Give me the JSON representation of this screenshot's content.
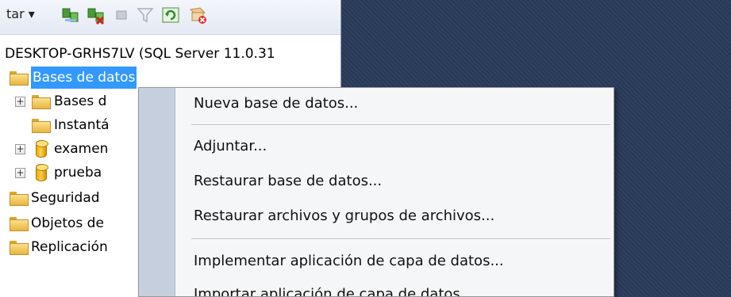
{
  "toolbar": {
    "label": "tar ▾",
    "buttons": [
      "connect-icon",
      "disconnect-icon",
      "stop-icon",
      "filter-icon",
      "refresh-icon",
      "delete-icon"
    ]
  },
  "tree": {
    "server": "DESKTOP-GRHS7LV (SQL Server 11.0.31",
    "items": [
      {
        "label": "Bases de datos",
        "icon": "folder-icon",
        "selected": true
      },
      {
        "label": "Bases d",
        "icon": "folder-icon",
        "expander": "+"
      },
      {
        "label": "Instantá",
        "icon": "folder-icon"
      },
      {
        "label": "examen",
        "icon": "database-icon",
        "expander": "+"
      },
      {
        "label": "prueba",
        "icon": "database-icon",
        "expander": "+"
      },
      {
        "label": "Seguridad",
        "icon": "folder-icon"
      },
      {
        "label": "Objetos de",
        "icon": "folder-icon"
      },
      {
        "label": "Replicación",
        "icon": "folder-icon"
      }
    ]
  },
  "context_menu": {
    "items": [
      {
        "label": "Nueva base de datos..."
      },
      {
        "label": "Adjuntar..."
      },
      {
        "label": "Restaurar base de datos..."
      },
      {
        "label": "Restaurar archivos y grupos de archivos..."
      },
      {
        "label": "Implementar aplicación de capa de datos..."
      },
      {
        "label": "Importar aplicación de capa de datos..."
      }
    ]
  },
  "colors": {
    "selection": "#3399ff",
    "background_dark": "#293a5a",
    "menu_gutter": "#c5cfdd"
  }
}
